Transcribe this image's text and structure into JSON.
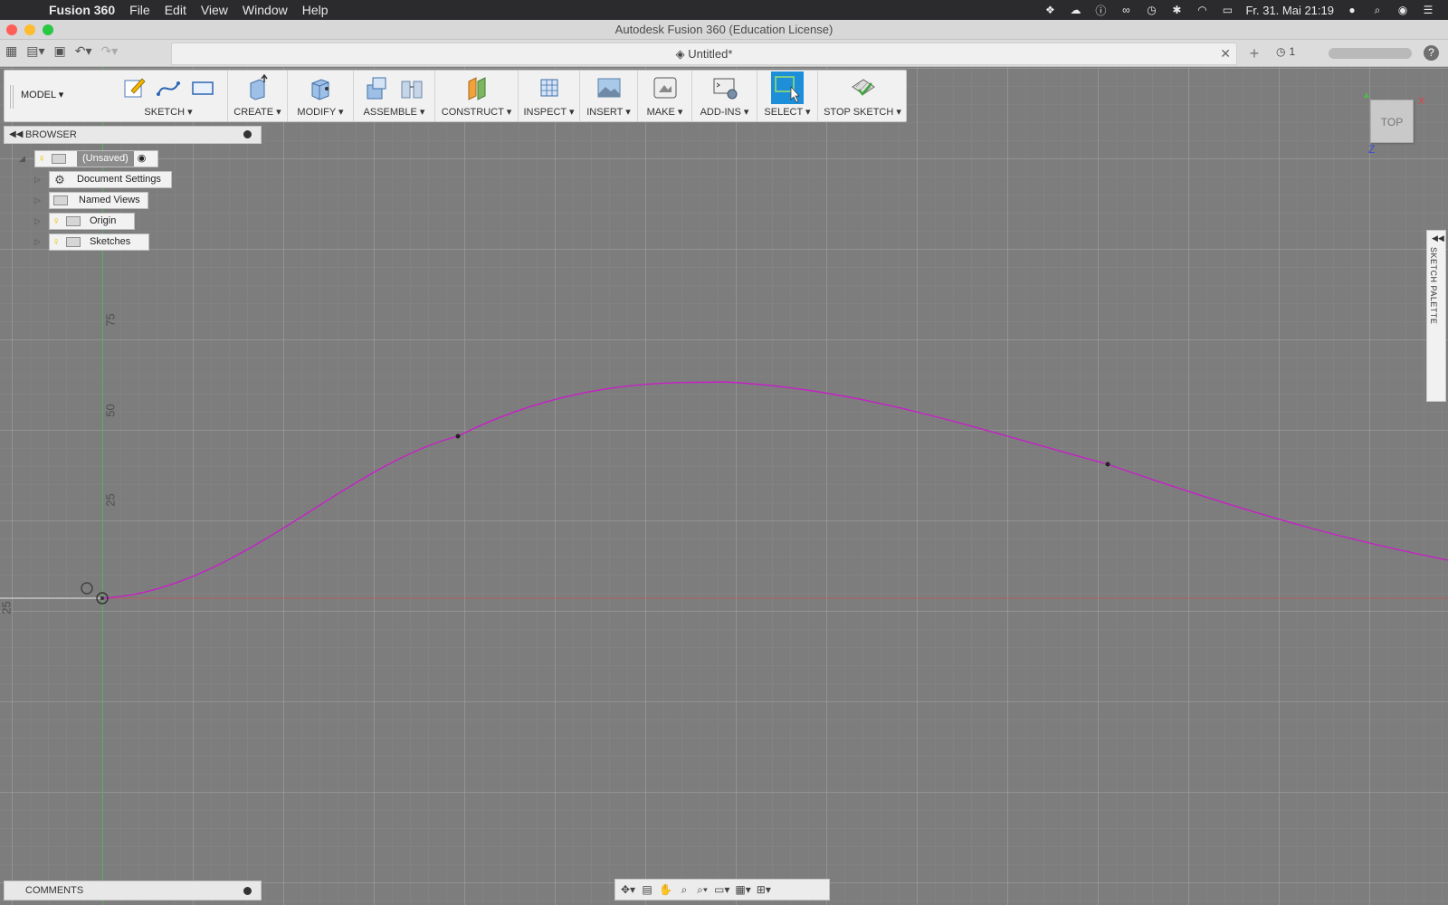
{
  "menubar": {
    "app_name": "Fusion 360",
    "items": [
      "File",
      "Edit",
      "View",
      "Window",
      "Help"
    ],
    "clock": "Fr. 31. Mai  21:19"
  },
  "window": {
    "title": "Autodesk Fusion 360 (Education License)"
  },
  "tabbar": {
    "doc_tab": "Untitled*",
    "jobs_count": "1"
  },
  "toolbar": {
    "workspace": "MODEL",
    "groups": {
      "sketch": "SKETCH",
      "create": "CREATE",
      "modify": "MODIFY",
      "assemble": "ASSEMBLE",
      "construct": "CONSTRUCT",
      "inspect": "INSPECT",
      "insert": "INSERT",
      "make": "MAKE",
      "addins": "ADD-INS",
      "select": "SELECT",
      "stop_sketch": "STOP SKETCH"
    }
  },
  "browser": {
    "title": "BROWSER",
    "root": "(Unsaved)",
    "items": [
      "Document Settings",
      "Named Views",
      "Origin",
      "Sketches"
    ]
  },
  "canvas": {
    "y_ticks": [
      "75",
      "50",
      "25"
    ],
    "x_tick": "25",
    "viewcube_face": "TOP",
    "axis_x": "X",
    "axis_z": "Z"
  },
  "sketch_palette": {
    "label": "SKETCH PALETTE"
  },
  "comments": {
    "title": "COMMENTS"
  },
  "colors": {
    "spline": "#c71fc7",
    "select_accent": "#1c8fd8",
    "grid_bg": "#7d7d7d"
  }
}
